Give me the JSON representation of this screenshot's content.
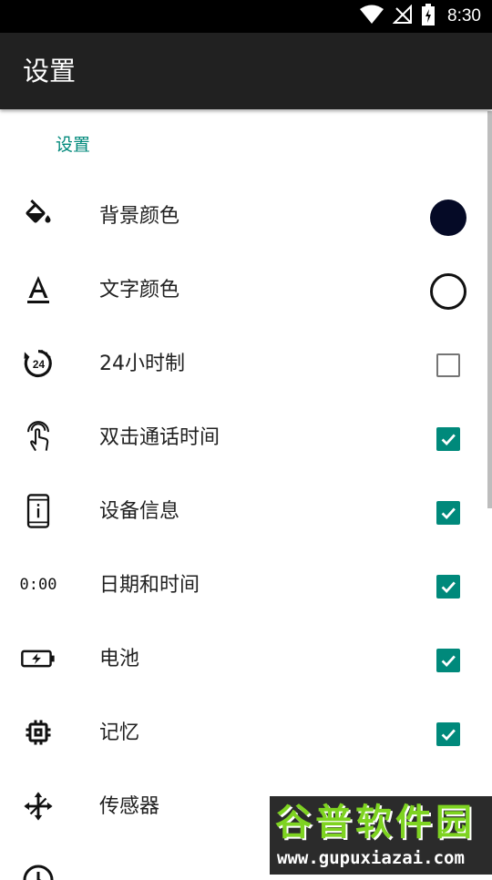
{
  "status_bar": {
    "time": "8:30",
    "icons": [
      "wifi-icon",
      "no-signal-icon",
      "battery-charging-icon"
    ]
  },
  "app_bar": {
    "title": "设置"
  },
  "section": {
    "header": "设置"
  },
  "rows": [
    {
      "label": "背景颜色",
      "icon": "paint-bucket-icon",
      "control": "color",
      "color": "#050a26"
    },
    {
      "label": "文字颜色",
      "icon": "text-color-icon",
      "control": "color",
      "color": "#ffffff"
    },
    {
      "label": "24小时制",
      "icon": "24-hour-icon",
      "control": "checkbox",
      "checked": false
    },
    {
      "label": "双击通话时间",
      "icon": "touch-gesture-icon",
      "control": "checkbox",
      "checked": true
    },
    {
      "label": "设备信息",
      "icon": "phone-info-icon",
      "control": "checkbox",
      "checked": true
    },
    {
      "label": "日期和时间",
      "icon": "digital-clock-icon",
      "icon_text": "0:00",
      "control": "checkbox",
      "checked": true
    },
    {
      "label": "电池",
      "icon": "battery-icon",
      "control": "checkbox",
      "checked": true
    },
    {
      "label": "记忆",
      "icon": "memory-chip-icon",
      "control": "checkbox",
      "checked": true
    },
    {
      "label": "传感器",
      "icon": "sensor-icon",
      "control": "checkbox",
      "checked": true
    }
  ],
  "watermark": {
    "title": "谷普软件园",
    "url": "www.gupuxiazai.com"
  },
  "colors": {
    "accent": "#00897B",
    "app_bar": "#212121",
    "status_bar": "#000000"
  }
}
